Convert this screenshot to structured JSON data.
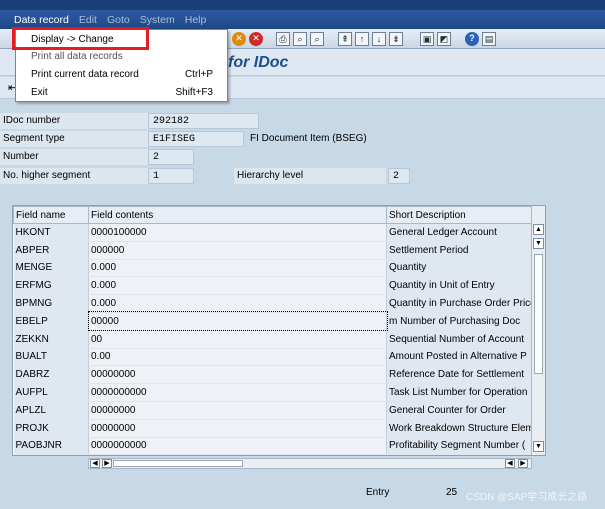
{
  "menubar": {
    "items": [
      "Data record",
      "Edit",
      "Goto",
      "System",
      "Help"
    ]
  },
  "title": "for IDoc",
  "dropdown": {
    "items": [
      {
        "label": "Display -> Change",
        "shortcut": ""
      },
      {
        "label": "Print all data records",
        "shortcut": ""
      },
      {
        "label": "Print current data record",
        "shortcut": "Ctrl+P"
      },
      {
        "label": "Exit",
        "shortcut": "Shift+F3"
      }
    ]
  },
  "header": {
    "idoc_number_label": "IDoc number",
    "idoc_number": "292182",
    "segment_type_label": "Segment type",
    "segment_type": "E1FISEG",
    "segment_desc": "FI Document Item (BSEG)",
    "number_label": "Number",
    "number": "2",
    "higher_segment_label": "No. higher segment",
    "higher_segment": "1",
    "hierarchy_label": "Hierarchy level",
    "hierarchy": "2"
  },
  "table": {
    "columns": [
      "Field name",
      "Field contents",
      "Short Description"
    ],
    "rows": [
      [
        "HKONT",
        "0000100000",
        "General Ledger Account"
      ],
      [
        "ABPER",
        "000000",
        "Settlement Period"
      ],
      [
        "MENGE",
        "0.000",
        "Quantity"
      ],
      [
        "ERFMG",
        "0.000",
        "Quantity in Unit of Entry"
      ],
      [
        "BPMNG",
        "0.000",
        "Quantity in Purchase Order Price"
      ],
      [
        "EBELP",
        "00000",
        "m Number of Purchasing Doc"
      ],
      [
        "ZEKKN",
        "00",
        "Sequential Number of Account"
      ],
      [
        "BUALT",
        "0.00",
        "Amount Posted in Alternative P"
      ],
      [
        "DABRZ",
        "00000000",
        "Reference Date for Settlement"
      ],
      [
        "AUFPL",
        "0000000000",
        "Task List Number for Operation"
      ],
      [
        "APLZL",
        "00000000",
        "General Counter for Order"
      ],
      [
        "PROJK",
        "00000000",
        "Work Breakdown Structure Elem"
      ],
      [
        "PAOBJNR",
        "0000000000",
        "Profitability Segment Number ("
      ]
    ]
  },
  "status": {
    "entry_label": "Entry",
    "entry_value": "25"
  },
  "watermark": "CSDN @SAP学习成长之路"
}
